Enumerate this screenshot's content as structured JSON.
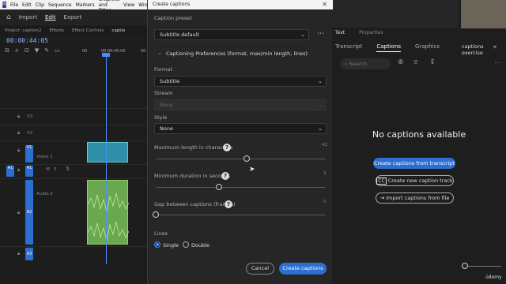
{
  "menu": {
    "items": [
      "File",
      "Edit",
      "Clip",
      "Sequence",
      "Markers",
      "Graphics and Titles",
      "View",
      "Wind"
    ]
  },
  "app": {
    "home": "Home",
    "import": "Import",
    "edit": "Edit",
    "export": "Export"
  },
  "left_tabs": [
    "Project: caption2",
    "Effects",
    "Effect Controls",
    "captio"
  ],
  "timecode": "00:00:44:05",
  "ruler": {
    "t1": "00",
    "t2": "00:00:45:00",
    "t3": "00"
  },
  "tracks": {
    "v3": "V3",
    "v2": "V2",
    "v1": "V1",
    "video1": "Video 1",
    "a1": "A1",
    "a1b": "A1",
    "a2": "A2",
    "audio2": "Audio 2",
    "a3": "A3",
    "m": "M",
    "s": "S"
  },
  "dialog": {
    "title": "Create captions",
    "preset_label": "Caption preset",
    "preset_value": "Subtitle default",
    "prefs_label": "Captioning Preferences (format, max/min length, lines)",
    "format_label": "Format",
    "format_value": "Subtitle",
    "stream_label": "Stream",
    "stream_value": "None",
    "style_label": "Style",
    "style_value": "None",
    "maxlen_label": "Maximum length in characters",
    "maxlen_max": "42",
    "mindur_label": "Minimum duration in seconds",
    "mindur_max": "3",
    "gap_label": "Gap between captions (frames)",
    "gap_max": "0",
    "lines_label": "Lines",
    "single": "Single",
    "double": "Double",
    "cancel": "Cancel",
    "create": "Create captions"
  },
  "right": {
    "tab_text": "Text",
    "tab_properties": "Properties",
    "tab_transcript": "Transcript",
    "tab_captions": "Captions",
    "tab_graphics": "Graphics",
    "project": "captions exercise",
    "search_placeholder": "Search",
    "no_captions": "No captions available",
    "btn_transcript": "Create captions from transcript",
    "btn_new_track": "Create new caption track",
    "btn_import": "Import captions from file",
    "watermark": "ūdemy"
  }
}
